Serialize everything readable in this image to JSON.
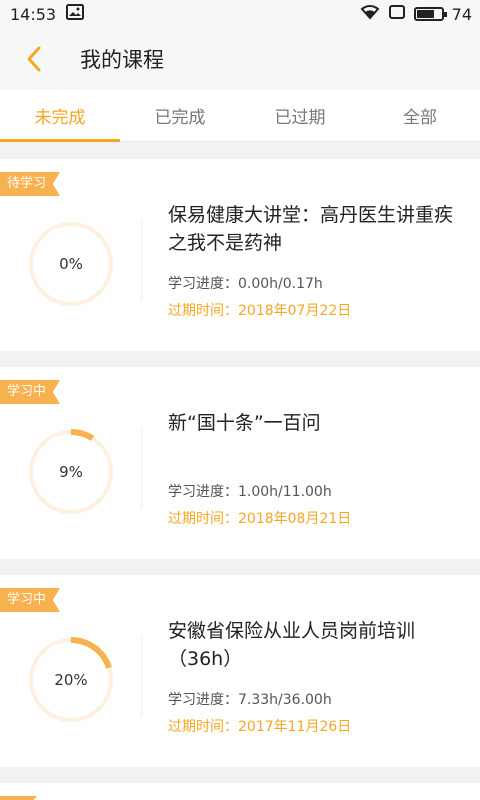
{
  "status_bar": {
    "time": "14:53",
    "battery": "74",
    "battery_level": 0.74,
    "icons": [
      "image-icon",
      "wifi-icon",
      "sim-icon",
      "battery-icon"
    ]
  },
  "header": {
    "title": "我的课程",
    "back_icon": "chevron-left-icon"
  },
  "tabs": [
    {
      "label": "未完成",
      "active": true
    },
    {
      "label": "已完成",
      "active": false
    },
    {
      "label": "已过期",
      "active": false
    },
    {
      "label": "全部",
      "active": false
    }
  ],
  "colors": {
    "accent": "#f5a623",
    "badge": "#f7b14e",
    "ring_track": "#fdf0e0",
    "ring_fill": "#f7b14e"
  },
  "courses": [
    {
      "badge": "待学习",
      "percent_label": "0%",
      "percent": 0,
      "title": "保易健康大讲堂：高丹医生讲重疾之我不是药神",
      "progress": "学习进度：0.00h/0.17h",
      "expire": "过期时间：2018年07月22日"
    },
    {
      "badge": "学习中",
      "percent_label": "9%",
      "percent": 9,
      "title": "新“国十条”一百问",
      "progress": "学习进度：1.00h/11.00h",
      "expire": "过期时间：2018年08月21日"
    },
    {
      "badge": "学习中",
      "percent_label": "20%",
      "percent": 20,
      "title": "安徽省保险从业人员岗前培训（36h）",
      "progress": "学习进度：7.33h/36.00h",
      "expire": "过期时间：2017年11月26日"
    }
  ]
}
